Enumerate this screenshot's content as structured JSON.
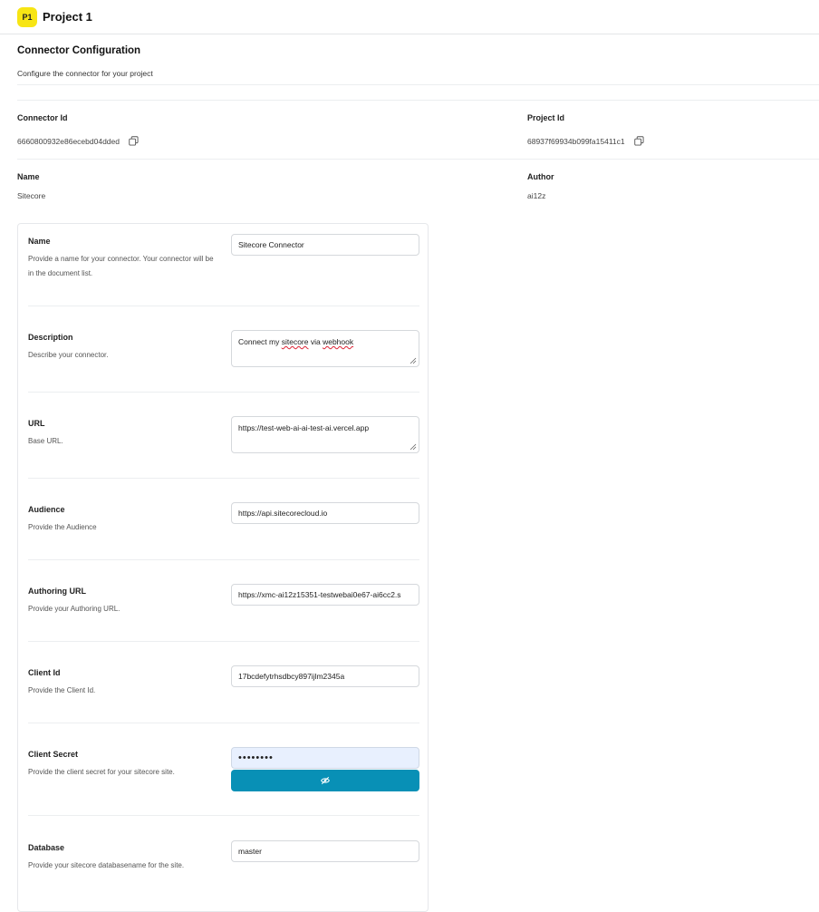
{
  "header": {
    "avatar_initials": "P1",
    "project_name": "Project 1",
    "avatar_color": "#f7e514"
  },
  "section": {
    "title": "Connector Configuration",
    "subtitle": "Configure the connector for your project"
  },
  "meta": {
    "connector_id_label": "Connector Id",
    "connector_id_value": "6660800932e86ecebd04dded",
    "project_id_label": "Project Id",
    "project_id_value": "68937f69934b099fa15411c1",
    "name_label": "Name",
    "name_value": "Sitecore",
    "author_label": "Author",
    "author_value": "ai12z"
  },
  "form": {
    "name": {
      "label": "Name",
      "help": "Provide a name for your connector. Your connector will be in the document list.",
      "value": "Sitecore Connector"
    },
    "description": {
      "label": "Description",
      "help": "Describe your connector.",
      "value_prefix": "Connect my ",
      "value_mid": "sitecore",
      "value_mid2": " via ",
      "value_end": "webhook"
    },
    "url": {
      "label": "URL",
      "help": "Base URL.",
      "value": "https://test-web-ai-ai-test-ai.vercel.app"
    },
    "audience": {
      "label": "Audience",
      "help": "Provide the Audience",
      "value": "https://api.sitecorecloud.io"
    },
    "authoring_url": {
      "label": "Authoring URL",
      "help": "Provide your Authoring URL.",
      "value": "https://xmc-ai12z15351-testwebai0e67-ai6cc2.s"
    },
    "client_id": {
      "label": "Client Id",
      "help": "Provide the Client Id.",
      "value": "17bcdefytrhsdbcy897ijlm2345a"
    },
    "client_secret": {
      "label": "Client Secret",
      "help": "Provide the client secret for your sitecore site.",
      "value": "••••••••",
      "reveal_icon": "eye-off-icon"
    },
    "database": {
      "label": "Database",
      "help": "Provide your sitecore databasename for the site.",
      "value": "master"
    }
  },
  "colors": {
    "accent": "#0890b6",
    "secret_bg": "#e8f0fe"
  }
}
